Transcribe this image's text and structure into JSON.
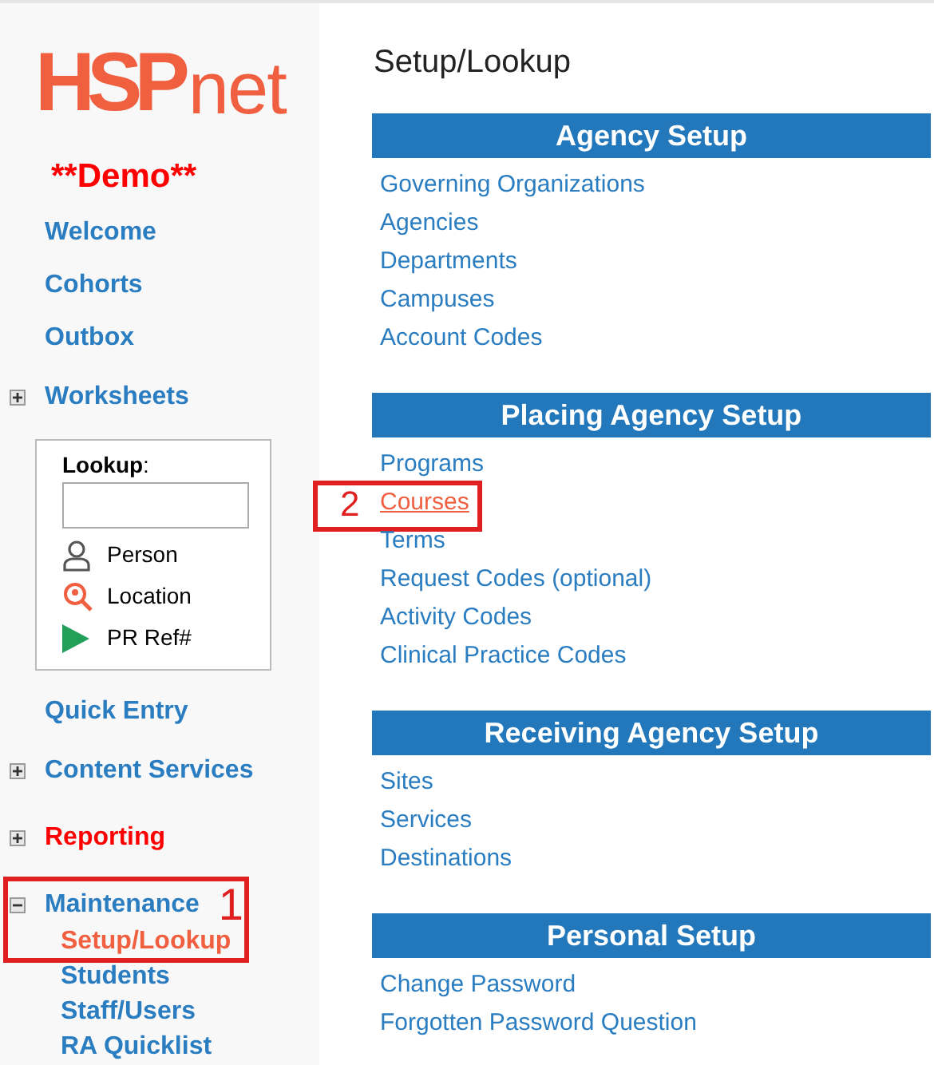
{
  "sidebar": {
    "logo": {
      "strong": "HSP",
      "light": "net"
    },
    "demo_label": "**Demo**",
    "nav_top": [
      {
        "label": "Welcome",
        "kind": "link",
        "alert": false
      },
      {
        "label": "Cohorts",
        "kind": "link",
        "alert": false
      },
      {
        "label": "Outbox",
        "kind": "link",
        "alert": false
      },
      {
        "label": "Worksheets",
        "kind": "group",
        "expanded": false,
        "alert": false
      }
    ],
    "lookup": {
      "label": "Lookup",
      "colon": ":",
      "options": [
        {
          "label": "Person",
          "kind": "person"
        },
        {
          "label": "Location",
          "kind": "location"
        },
        {
          "label": "PR Ref#",
          "kind": "ref"
        }
      ]
    },
    "nav_bottom": [
      {
        "label": "Quick Entry",
        "kind": "link",
        "alert": false
      },
      {
        "label": "Content Services",
        "kind": "group",
        "expanded": false,
        "alert": false
      },
      {
        "label": "Reporting",
        "kind": "group",
        "expanded": false,
        "alert": true
      },
      {
        "label": "Maintenance",
        "kind": "group",
        "expanded": true,
        "alert": false,
        "annotation": "1",
        "children": [
          {
            "label": "Setup/Lookup",
            "selected": true
          },
          {
            "label": "Students",
            "selected": false
          },
          {
            "label": "Staff/Users",
            "selected": false
          },
          {
            "label": "RA Quicklist",
            "selected": false
          }
        ]
      }
    ]
  },
  "main": {
    "title": "Setup/Lookup",
    "sections": [
      {
        "heading": "Agency Setup",
        "links": [
          {
            "label": "Governing Organizations",
            "selected": false
          },
          {
            "label": "Agencies",
            "selected": false
          },
          {
            "label": "Departments",
            "selected": false
          },
          {
            "label": "Campuses",
            "selected": false
          },
          {
            "label": "Account Codes",
            "selected": false
          }
        ]
      },
      {
        "heading": "Placing Agency Setup",
        "links": [
          {
            "label": "Programs",
            "selected": false
          },
          {
            "label": "Courses",
            "selected": true,
            "annotation": "2"
          },
          {
            "label": "Terms",
            "selected": false
          },
          {
            "label": "Request Codes (optional)",
            "selected": false
          },
          {
            "label": "Activity Codes",
            "selected": false
          },
          {
            "label": "Clinical Practice Codes",
            "selected": false
          }
        ]
      },
      {
        "heading": "Receiving Agency Setup",
        "links": [
          {
            "label": "Sites",
            "selected": false
          },
          {
            "label": "Services",
            "selected": false
          },
          {
            "label": "Destinations",
            "selected": false
          }
        ]
      },
      {
        "heading": "Personal Setup",
        "links": [
          {
            "label": "Change Password",
            "selected": false
          },
          {
            "label": "Forgotten Password Question",
            "selected": false
          }
        ]
      }
    ]
  }
}
